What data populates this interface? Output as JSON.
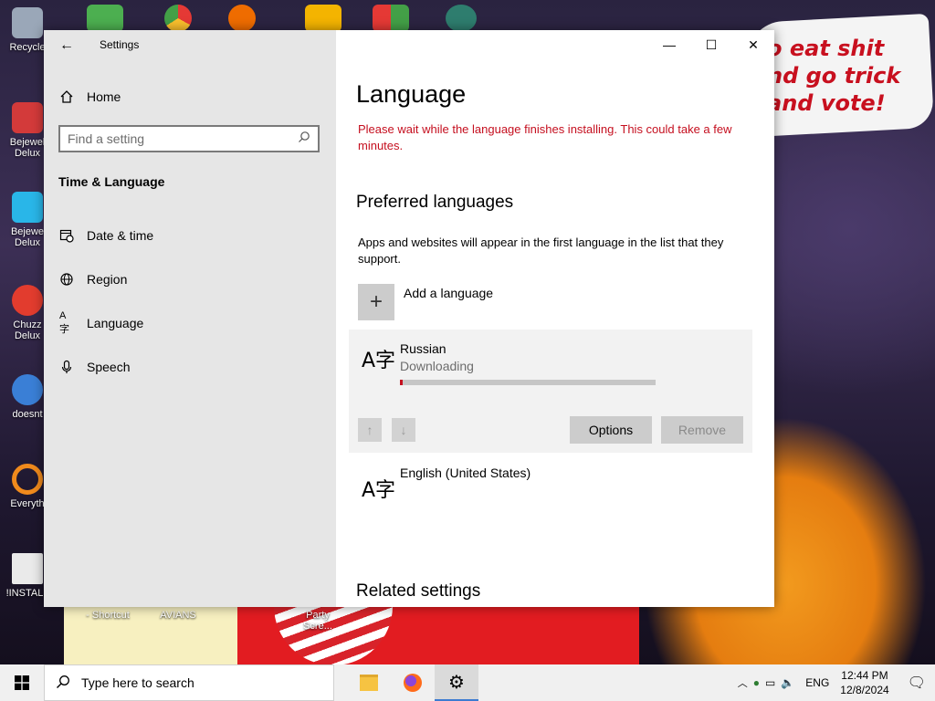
{
  "desktop": {
    "banner_lines": [
      "o eat shit",
      "nd go trick",
      "and vote!"
    ],
    "icons_left": [
      "Recycle",
      "Bejewel Delux",
      "Bejewe Delux",
      "Chuzz Delux",
      "doesnt",
      "Everyth",
      "!INSTALL"
    ],
    "icons_bottom": [
      "- Shortcut",
      "AVIANS",
      "Party Scre..."
    ]
  },
  "window": {
    "title": "Settings",
    "controls": {
      "minimize": "—",
      "maximize": "☐",
      "close": "✕"
    }
  },
  "sidebar": {
    "home": "Home",
    "search_placeholder": "Find a setting",
    "section": "Time & Language",
    "items": [
      {
        "label": "Date & time",
        "icon": "calendar-clock-icon"
      },
      {
        "label": "Region",
        "icon": "globe-icon"
      },
      {
        "label": "Language",
        "icon": "language-icon"
      },
      {
        "label": "Speech",
        "icon": "microphone-icon"
      }
    ]
  },
  "main": {
    "title": "Language",
    "warning": "Please wait while the language finishes installing. This could take a few minutes.",
    "preferred_heading": "Preferred languages",
    "preferred_desc": "Apps and websites will appear in the first language in the list that they support.",
    "add_language": "Add a language",
    "languages": [
      {
        "name": "Russian",
        "status": "Downloading",
        "progress": 0.01,
        "glyph": "A字"
      },
      {
        "name": "English (United States)",
        "glyph": "A字"
      }
    ],
    "buttons": {
      "options": "Options",
      "remove": "Remove"
    },
    "related_heading": "Related settings"
  },
  "taskbar": {
    "search_placeholder": "Type here to search",
    "lang": "ENG",
    "time": "12:44 PM",
    "date": "12/8/2024"
  },
  "colors": {
    "warning": "#c50f1f",
    "accent": "#3c7bd1"
  }
}
